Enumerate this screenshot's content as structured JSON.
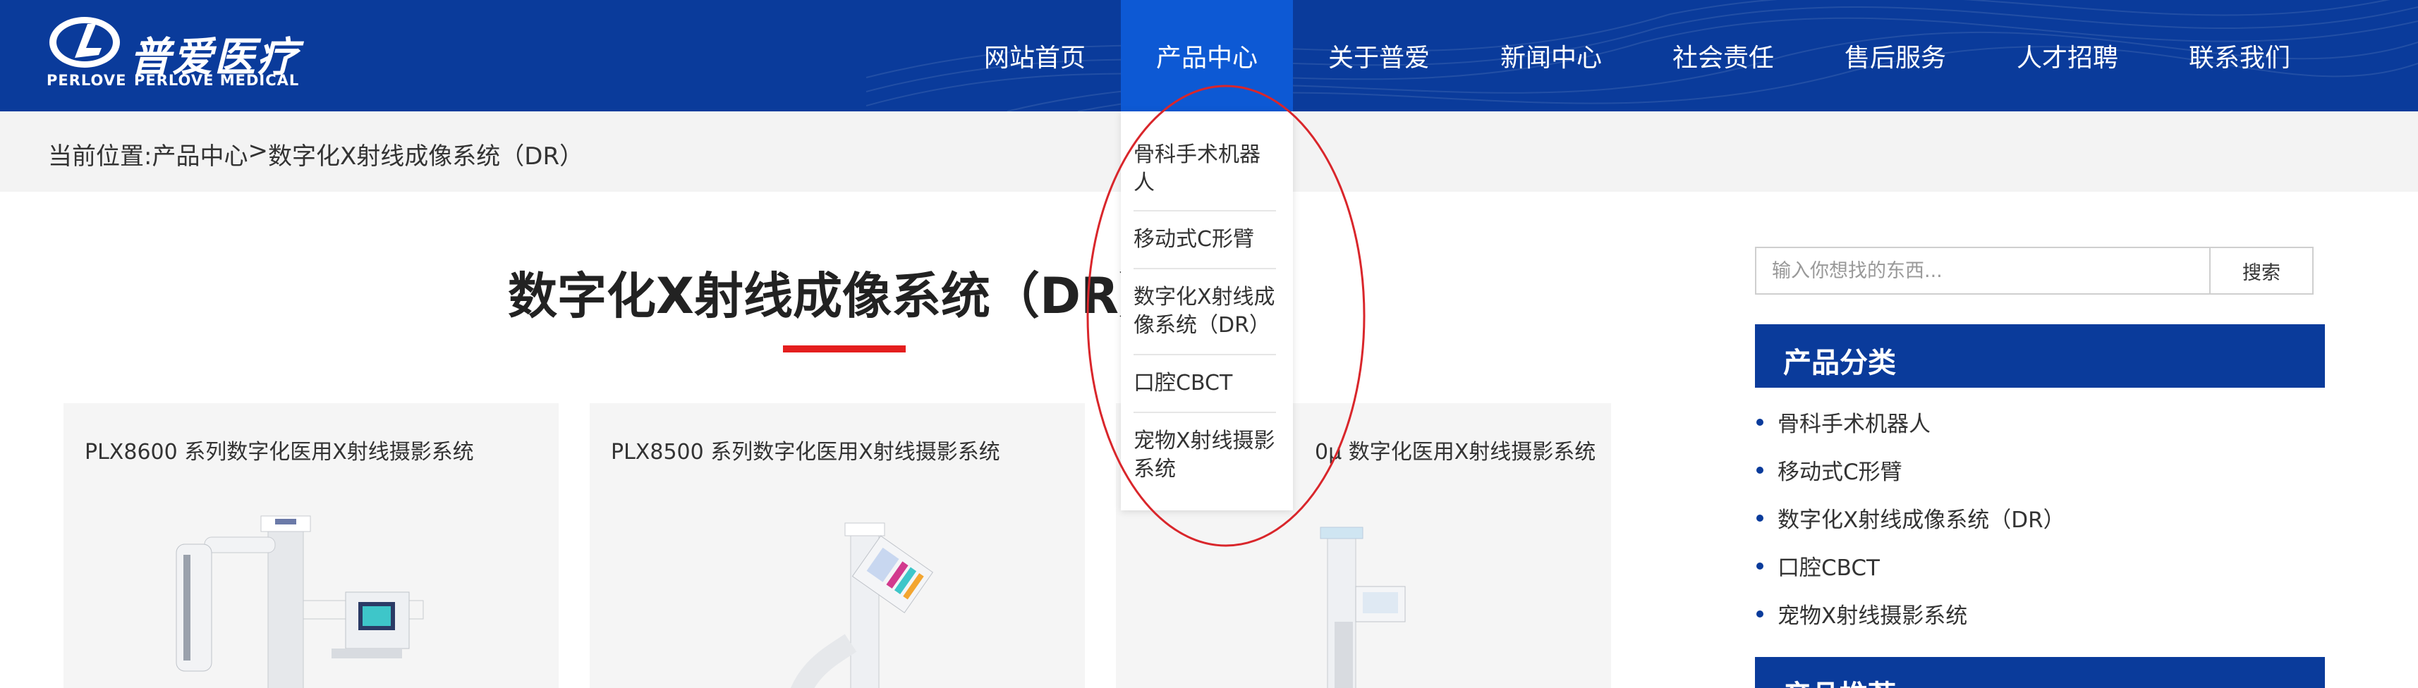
{
  "header": {
    "logo_cn": "普爱医疗",
    "logo_en_left": "PERLOVE",
    "logo_en_right": "PERLOVE MEDICAL",
    "nav": [
      {
        "label": "网站首页"
      },
      {
        "label": "产品中心",
        "active": true
      },
      {
        "label": "关于普爱"
      },
      {
        "label": "新闻中心"
      },
      {
        "label": "社会责任"
      },
      {
        "label": "售后服务"
      },
      {
        "label": "人才招聘"
      },
      {
        "label": "联系我们"
      }
    ],
    "colors": {
      "bar": "#0a3b9b",
      "active": "#0d59d4"
    }
  },
  "breadcrumb": {
    "prefix": "当前位置: ",
    "parent": "产品中心",
    "separator": "> ",
    "current": "数字化X射线成像系统（DR）"
  },
  "dropdown": {
    "items": [
      {
        "label": "骨科手术机器人"
      },
      {
        "label": "移动式C形臂"
      },
      {
        "label": "数字化X射线成像系统（DR）"
      },
      {
        "label": "口腔CBCT"
      },
      {
        "label": "宠物X射线摄影系统"
      }
    ]
  },
  "main": {
    "title": "数字化X射线成像系统（DR）",
    "accent_color": "#e41e1e",
    "cards": [
      {
        "title": "PLX8600 系列数字化医用X射线摄影系统",
        "image_icon": "x-ray-machine-image"
      },
      {
        "title": "PLX8500 系列数字化医用X射线摄影系统",
        "image_icon": "x-ray-machine-image"
      },
      {
        "title": "0μ 数字化医用X射线摄影系统",
        "image_icon": "x-ray-machine-image"
      }
    ]
  },
  "sidebar": {
    "search_placeholder": "输入你想找的东西...",
    "search_button": "搜索",
    "category_heading": "产品分类",
    "categories": [
      {
        "label": "骨科手术机器人"
      },
      {
        "label": "移动式C形臂"
      },
      {
        "label": "数字化X射线成像系统（DR）"
      },
      {
        "label": "口腔CBCT"
      },
      {
        "label": "宠物X射线摄影系统"
      }
    ],
    "recommend_heading": "产品推荐"
  }
}
